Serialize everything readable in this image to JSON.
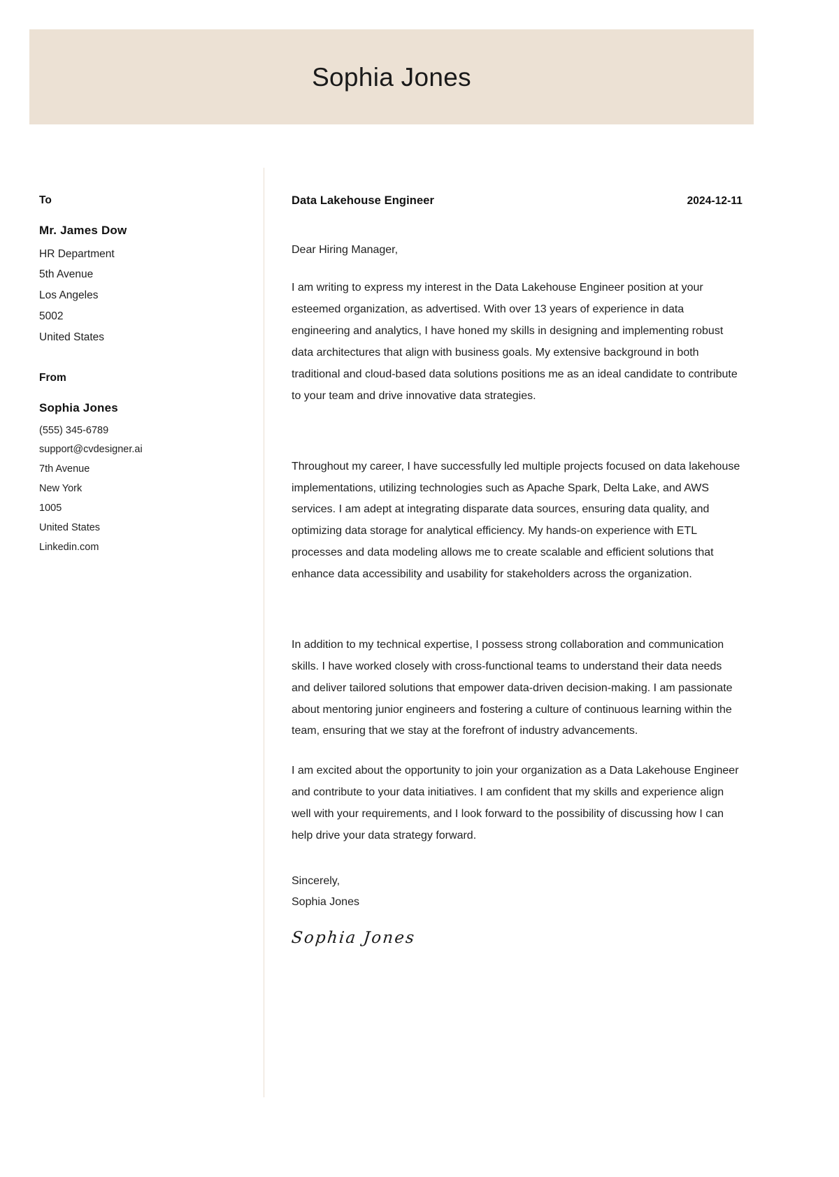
{
  "header": {
    "full_name": "Sophia Jones",
    "band_color": "#ece1d4"
  },
  "divider": {
    "color": "#e9ded2"
  },
  "recipient": {
    "heading": "To",
    "name": "Mr. James Dow",
    "lines": [
      "HR Department",
      "5th Avenue",
      "Los Angeles",
      "5002",
      "United States"
    ]
  },
  "sender": {
    "heading": "From",
    "name": "Sophia Jones",
    "lines": [
      "(555) 345-6789",
      "support@cvdesigner.ai",
      "7th Avenue",
      "New York",
      "1005",
      "United States",
      "Linkedin.com"
    ]
  },
  "letter": {
    "job_title": "Data Lakehouse Engineer",
    "date": "2024-12-11",
    "salutation": "Dear Hiring Manager,",
    "paragraphs": [
      "I am writing to express my interest in the Data Lakehouse Engineer position at your esteemed organization, as advertised. With over 13 years of experience in data engineering and analytics, I have honed my skills in designing and implementing robust data architectures that align with business goals. My extensive background in both traditional and cloud-based data solutions positions me as an ideal candidate to contribute to your team and drive innovative data strategies.",
      "Throughout my career, I have successfully led multiple projects focused on data lakehouse implementations, utilizing technologies such as Apache Spark, Delta Lake, and AWS services. I am adept at integrating disparate data sources, ensuring data quality, and optimizing data storage for analytical efficiency. My hands-on experience with ETL processes and data modeling allows me to create scalable and efficient solutions that enhance data accessibility and usability for stakeholders across the organization.",
      "In addition to my technical expertise, I possess strong collaboration and communication skills. I have worked closely with cross-functional teams to understand their data needs and deliver tailored solutions that empower data-driven decision-making. I am passionate about mentoring junior engineers and fostering a culture of continuous learning within the team, ensuring that we stay at the forefront of industry advancements.",
      "I am excited about the opportunity to join your organization as a Data Lakehouse Engineer and contribute to your data initiatives. I am confident that my skills and experience align well with your requirements, and I look forward to the possibility of discussing how I can help drive your data strategy forward."
    ],
    "closing_salutation": "Sincerely,",
    "closing_name": "Sophia Jones",
    "signature": "Sophia Jones"
  }
}
